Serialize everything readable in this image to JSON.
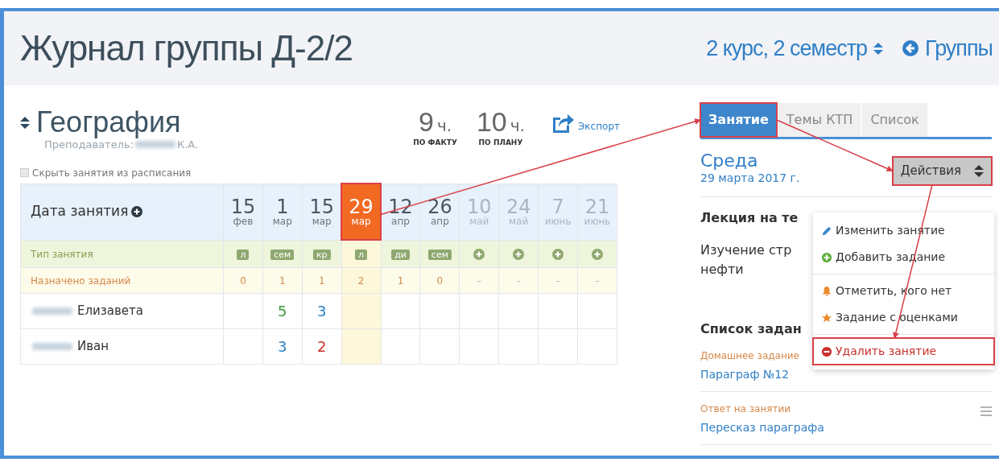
{
  "header": {
    "title": "Журнал группы Д-2/2",
    "term": "2 курс, 2 семестр",
    "groups_link": "Группы"
  },
  "subject": {
    "title": "География",
    "teacher_label": "Преподаватель:",
    "teacher_initials": "К.А."
  },
  "hours": [
    {
      "value": "9",
      "unit": "ч.",
      "caption": "ПО ФАКТУ"
    },
    {
      "value": "10",
      "unit": "ч.",
      "caption": "ПО ПЛАНУ"
    }
  ],
  "export": "Экспорт",
  "hide_option": {
    "label": "Скрыть занятия из расписания",
    "checked": false
  },
  "table": {
    "date_header": "Дата занятия",
    "type_label": "Тип занятия",
    "assigned_label": "Назначено заданий",
    "columns": [
      {
        "day": "15",
        "month": "фев",
        "type": "л",
        "assigned": "0",
        "selected": false,
        "faded": false,
        "highlighted": false
      },
      {
        "day": "1",
        "month": "мар",
        "type": "сем",
        "assigned": "1",
        "selected": false,
        "faded": false,
        "highlighted": false
      },
      {
        "day": "15",
        "month": "мар",
        "type": "кр",
        "assigned": "1",
        "selected": false,
        "faded": false,
        "highlighted": false
      },
      {
        "day": "29",
        "month": "мар",
        "type": "л",
        "assigned": "2",
        "selected": true,
        "faded": false,
        "highlighted": true
      },
      {
        "day": "12",
        "month": "апр",
        "type": "ди",
        "assigned": "1",
        "selected": false,
        "faded": false,
        "highlighted": false
      },
      {
        "day": "26",
        "month": "апр",
        "type": "сем",
        "assigned": "0",
        "selected": false,
        "faded": false,
        "highlighted": false
      },
      {
        "day": "10",
        "month": "май",
        "assigned": "–",
        "selected": false,
        "faded": true,
        "highlighted": false
      },
      {
        "day": "24",
        "month": "май",
        "assigned": "–",
        "selected": false,
        "faded": true,
        "highlighted": false
      },
      {
        "day": "7",
        "month": "июнь",
        "assigned": "–",
        "selected": false,
        "faded": true,
        "highlighted": false
      },
      {
        "day": "21",
        "month": "июнь",
        "assigned": "–",
        "selected": false,
        "faded": true,
        "highlighted": false
      }
    ],
    "students": [
      {
        "name": "Елизавета",
        "grades": [
          {
            "kind": "empty"
          },
          {
            "kind": "grade",
            "value": "5",
            "color": "#3c9a3c"
          },
          {
            "kind": "grade",
            "value": "3",
            "color": "#2a7fc1"
          },
          {
            "kind": "empty"
          },
          {
            "kind": "empty"
          },
          {
            "kind": "empty"
          },
          {
            "kind": "empty"
          },
          {
            "kind": "empty"
          },
          {
            "kind": "empty"
          },
          {
            "kind": "empty"
          }
        ]
      },
      {
        "name": "Иван",
        "grades": [
          {
            "kind": "empty"
          },
          {
            "kind": "grade",
            "value": "3",
            "color": "#2a7fc1"
          },
          {
            "kind": "grade",
            "value": "2",
            "color": "#c9302c"
          },
          {
            "kind": "empty"
          },
          {
            "kind": "empty"
          },
          {
            "kind": "empty"
          },
          {
            "kind": "empty"
          },
          {
            "kind": "empty"
          },
          {
            "kind": "empty"
          },
          {
            "kind": "empty"
          }
        ]
      }
    ]
  },
  "tabs": [
    {
      "label": "Занятие",
      "selected": true,
      "highlighted": true
    },
    {
      "label": "Темы КТП",
      "selected": false,
      "highlighted": false
    },
    {
      "label": "Список",
      "selected": false,
      "highlighted": false
    }
  ],
  "lesson": {
    "weekday": "Среда",
    "date": "29 марта 2017 г.",
    "topic_heading": "Лекция на те",
    "topic_line1": "Изучение стр",
    "topic_line2": "нефти",
    "tasks_heading": "Список задан"
  },
  "actions": {
    "label": "Действия",
    "highlighted": true,
    "items": [
      {
        "kind": "edit",
        "label": "Изменить занятие",
        "highlighted": false
      },
      {
        "kind": "add",
        "label": "Добавить задание",
        "highlighted": false
      },
      {
        "kind": "absent",
        "label": "Отметить, кого нет",
        "highlighted": false
      },
      {
        "kind": "graded",
        "label": "Задание с оценками",
        "highlighted": false
      },
      {
        "kind": "delete",
        "label": "Удалить занятие",
        "highlighted": true
      }
    ]
  },
  "tasks": [
    {
      "type": "Домашнее задание",
      "title": "Параграф №12"
    },
    {
      "type": "Ответ на занятии",
      "title": "Пересказ параграфа"
    }
  ]
}
